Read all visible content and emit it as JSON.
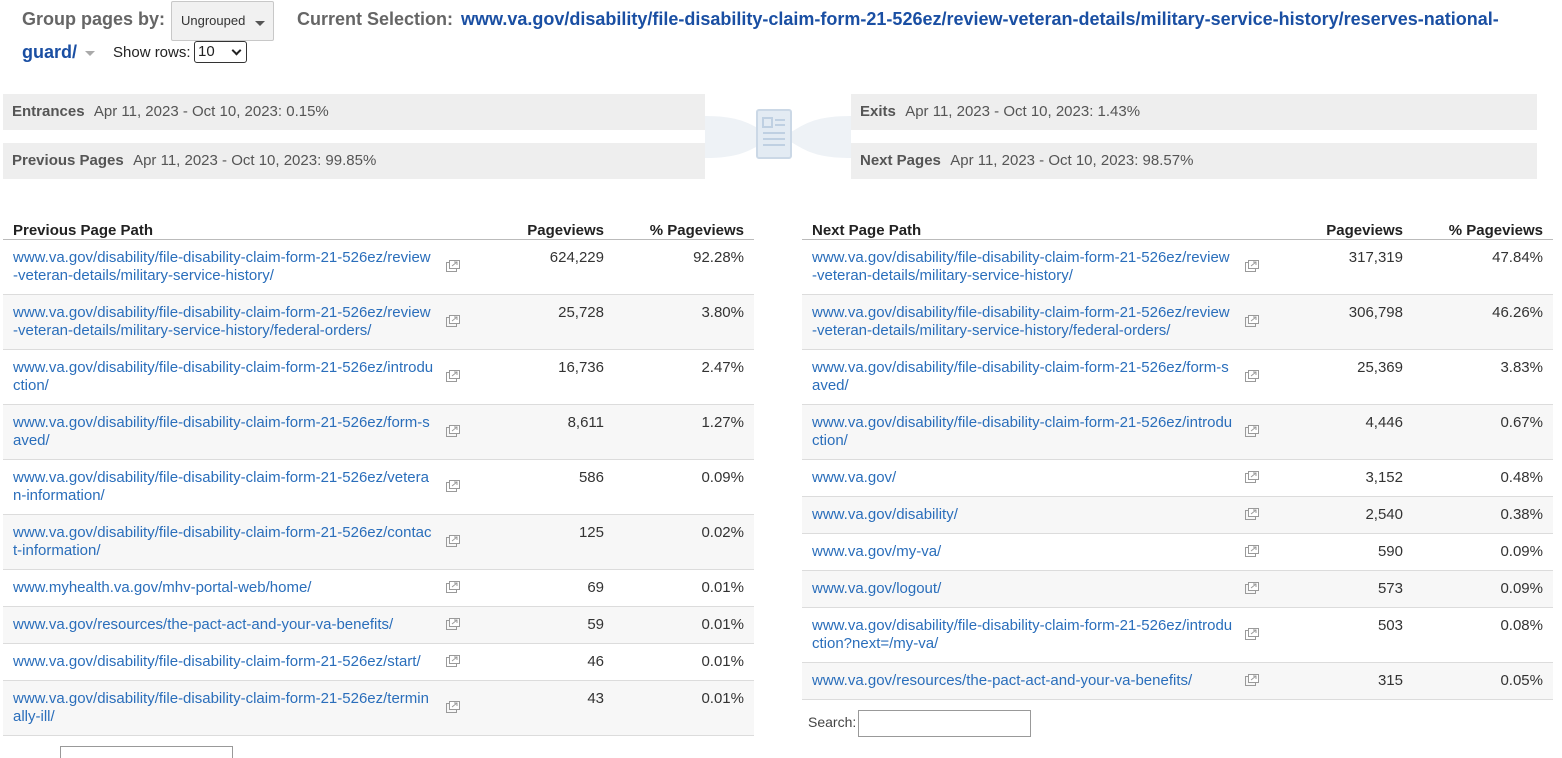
{
  "header": {
    "group_pages_label": "Group pages by:",
    "group_pages_value": "Ungrouped",
    "current_selection_label": "Current Selection:",
    "current_selection_url_line1": "www.va.gov/disability/file-disability-claim-form-21-526ez/review-veteran-details/military-service-history/reserves-national-",
    "current_selection_url_line2": "guard/",
    "show_rows_label": "Show rows:",
    "show_rows_value": "10"
  },
  "summary": {
    "entrances_label": "Entrances",
    "entrances_value": "Apr 11, 2023 - Oct 10, 2023: 0.15%",
    "previous_pages_label": "Previous Pages",
    "previous_pages_value": "Apr 11, 2023 - Oct 10, 2023: 99.85%",
    "exits_label": "Exits",
    "exits_value": "Apr 11, 2023 - Oct 10, 2023: 1.43%",
    "next_pages_label": "Next Pages",
    "next_pages_value": "Apr 11, 2023 - Oct 10, 2023: 98.57%"
  },
  "previous_table": {
    "headers": [
      "Previous Page Path",
      "Pageviews",
      "% Pageviews"
    ],
    "rows": [
      {
        "path": "www.va.gov/disability/file-disability-claim-form-21-526ez/review-veteran-details/military-service-history/",
        "pageviews": "624,229",
        "pct": "92.28%"
      },
      {
        "path": "www.va.gov/disability/file-disability-claim-form-21-526ez/review-veteran-details/military-service-history/federal-orders/",
        "pageviews": "25,728",
        "pct": "3.80%"
      },
      {
        "path": "www.va.gov/disability/file-disability-claim-form-21-526ez/introduction/",
        "pageviews": "16,736",
        "pct": "2.47%"
      },
      {
        "path": "www.va.gov/disability/file-disability-claim-form-21-526ez/form-saved/",
        "pageviews": "8,611",
        "pct": "1.27%"
      },
      {
        "path": "www.va.gov/disability/file-disability-claim-form-21-526ez/veteran-information/",
        "pageviews": "586",
        "pct": "0.09%"
      },
      {
        "path": "www.va.gov/disability/file-disability-claim-form-21-526ez/contact-information/",
        "pageviews": "125",
        "pct": "0.02%"
      },
      {
        "path": "www.myhealth.va.gov/mhv-portal-web/home/",
        "pageviews": "69",
        "pct": "0.01%"
      },
      {
        "path": "www.va.gov/resources/the-pact-act-and-your-va-benefits/",
        "pageviews": "59",
        "pct": "0.01%"
      },
      {
        "path": "www.va.gov/disability/file-disability-claim-form-21-526ez/start/",
        "pageviews": "46",
        "pct": "0.01%"
      },
      {
        "path": "www.va.gov/disability/file-disability-claim-form-21-526ez/terminally-ill/",
        "pageviews": "43",
        "pct": "0.01%"
      }
    ]
  },
  "next_table": {
    "headers": [
      "Next Page Path",
      "Pageviews",
      "% Pageviews"
    ],
    "rows": [
      {
        "path": "www.va.gov/disability/file-disability-claim-form-21-526ez/review-veteran-details/military-service-history/",
        "pageviews": "317,319",
        "pct": "47.84%"
      },
      {
        "path": "www.va.gov/disability/file-disability-claim-form-21-526ez/review-veteran-details/military-service-history/federal-orders/",
        "pageviews": "306,798",
        "pct": "46.26%"
      },
      {
        "path": "www.va.gov/disability/file-disability-claim-form-21-526ez/form-saved/",
        "pageviews": "25,369",
        "pct": "3.83%"
      },
      {
        "path": "www.va.gov/disability/file-disability-claim-form-21-526ez/introduction/",
        "pageviews": "4,446",
        "pct": "0.67%"
      },
      {
        "path": "www.va.gov/",
        "pageviews": "3,152",
        "pct": "0.48%"
      },
      {
        "path": "www.va.gov/disability/",
        "pageviews": "2,540",
        "pct": "0.38%"
      },
      {
        "path": "www.va.gov/my-va/",
        "pageviews": "590",
        "pct": "0.09%"
      },
      {
        "path": "www.va.gov/logout/",
        "pageviews": "573",
        "pct": "0.09%"
      },
      {
        "path": "www.va.gov/disability/file-disability-claim-form-21-526ez/introduction?next=/my-va/",
        "pageviews": "503",
        "pct": "0.08%"
      },
      {
        "path": "www.va.gov/resources/the-pact-act-and-your-va-benefits/",
        "pageviews": "315",
        "pct": "0.05%"
      }
    ]
  },
  "search": {
    "label": "Search:",
    "value": ""
  },
  "icons": {
    "external_link": "external-link-icon",
    "page_flow": "page-document-icon"
  },
  "colors": {
    "link": "#2a6ebb",
    "selection": "#1a4fa3",
    "band": "#eeeeee"
  }
}
